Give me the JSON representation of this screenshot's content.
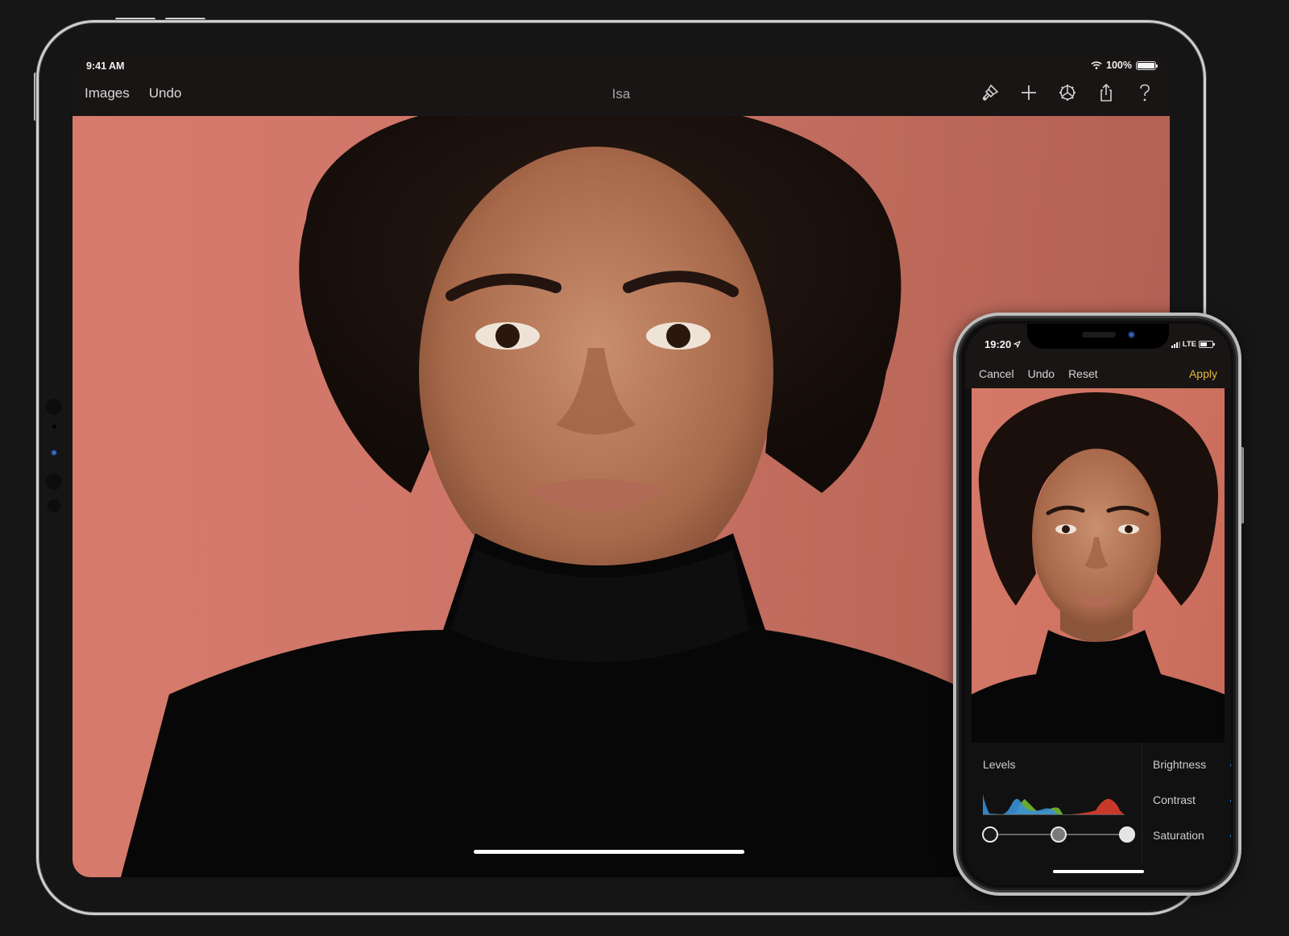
{
  "ipad": {
    "status_bar": {
      "time": "9:41 AM",
      "battery": "100%"
    },
    "toolbar": {
      "left_buttons": [
        {
          "label": "Images"
        },
        {
          "label": "Undo"
        }
      ],
      "title": "Isa",
      "right_icons": [
        {
          "name": "brush-icon",
          "label": "Edit tools"
        },
        {
          "name": "plus-icon",
          "label": "Add"
        },
        {
          "name": "gear-icon",
          "label": "Settings"
        },
        {
          "name": "share-icon",
          "label": "Share"
        },
        {
          "name": "help-icon",
          "label": "Help"
        }
      ]
    },
    "photo": {
      "subject": "Portrait of a woman with curly hair in a black turtleneck against a coral wall",
      "background_color": "#d77a6c"
    }
  },
  "iphone": {
    "status_bar": {
      "time": "19:20",
      "network": "LTE"
    },
    "toolbar": {
      "left_buttons": [
        {
          "label": "Cancel"
        },
        {
          "label": "Undo"
        },
        {
          "label": "Reset"
        }
      ],
      "apply_label": "Apply",
      "apply_color": "#e6b83e"
    },
    "photo": {
      "subject": "Same portrait, edit preview"
    },
    "panel": {
      "levels": {
        "label": "Levels",
        "histogram_channels": [
          {
            "name": "blue",
            "color": "#3a8fd6"
          },
          {
            "name": "green",
            "color": "#6aa82f"
          },
          {
            "name": "red",
            "color": "#c9392a"
          }
        ],
        "black_point": 0,
        "mid_point": 0.5,
        "white_point": 1
      },
      "adjustments": [
        {
          "label": "Brightness"
        },
        {
          "label": "Contrast"
        },
        {
          "label": "Saturation"
        }
      ],
      "accent_color": "#2f7fe0"
    }
  }
}
